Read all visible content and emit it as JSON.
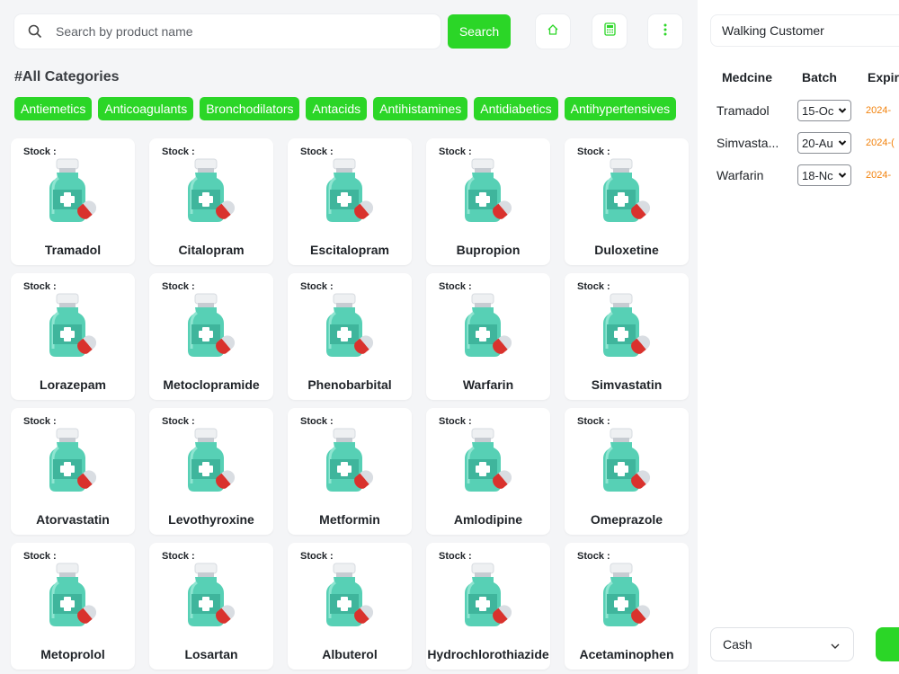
{
  "search": {
    "placeholder": "Search by product name",
    "button_label": "Search"
  },
  "toolbar": {
    "icons": [
      "home-icon",
      "calculator-icon",
      "more-vertical-icon"
    ]
  },
  "categories": {
    "title": "#All Categories",
    "items": [
      "Antiemetics",
      "Anticoagulants",
      "Bronchodilators",
      "Antacids",
      "Antihistamines",
      "Antidiabetics",
      "Antihypertensives"
    ]
  },
  "products": [
    {
      "stock_label": "Stock :",
      "name": "Tramadol"
    },
    {
      "stock_label": "Stock :",
      "name": "Citalopram"
    },
    {
      "stock_label": "Stock :",
      "name": "Escitalopram"
    },
    {
      "stock_label": "Stock :",
      "name": "Bupropion"
    },
    {
      "stock_label": "Stock :",
      "name": "Duloxetine"
    },
    {
      "stock_label": "Stock :",
      "name": "Lorazepam"
    },
    {
      "stock_label": "Stock :",
      "name": "Metoclopramide"
    },
    {
      "stock_label": "Stock :",
      "name": "Phenobarbital"
    },
    {
      "stock_label": "Stock :",
      "name": "Warfarin"
    },
    {
      "stock_label": "Stock :",
      "name": "Simvastatin"
    },
    {
      "stock_label": "Stock :",
      "name": "Atorvastatin"
    },
    {
      "stock_label": "Stock :",
      "name": "Levothyroxine"
    },
    {
      "stock_label": "Stock :",
      "name": "Metformin"
    },
    {
      "stock_label": "Stock :",
      "name": "Amlodipine"
    },
    {
      "stock_label": "Stock :",
      "name": "Omeprazole"
    },
    {
      "stock_label": "Stock :",
      "name": "Metoprolol"
    },
    {
      "stock_label": "Stock :",
      "name": "Losartan"
    },
    {
      "stock_label": "Stock :",
      "name": "Albuterol"
    },
    {
      "stock_label": "Stock :",
      "name": "Hydrochlorothiazide"
    },
    {
      "stock_label": "Stock :",
      "name": "Acetaminophen"
    }
  ],
  "cart": {
    "customer": "Walking Customer",
    "headers": [
      "Medcine",
      "Batch",
      "Expir"
    ],
    "rows": [
      {
        "medicine": "Tramadol",
        "batch": "15-Oc",
        "expiry": "2024-"
      },
      {
        "medicine": "Simvasta...",
        "batch": "20-Au",
        "expiry": "2024-("
      },
      {
        "medicine": "Warfarin",
        "batch": "18-Nc",
        "expiry": "2024-"
      }
    ],
    "payment_method": "Cash"
  },
  "colors": {
    "accent": "#2bd627",
    "expiry": "#f2820c",
    "background": "#f4f5f7"
  }
}
